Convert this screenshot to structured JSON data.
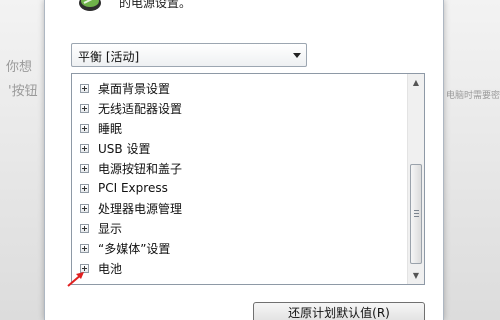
{
  "header": {
    "text": "的电源设置。"
  },
  "plan_select": {
    "value": "平衡 [活动]"
  },
  "tree": {
    "items": [
      {
        "label": "桌面背景设置"
      },
      {
        "label": "无线适配器设置"
      },
      {
        "label": "睡眠"
      },
      {
        "label": "USB 设置"
      },
      {
        "label": "电源按钮和盖子"
      },
      {
        "label": "PCI Express"
      },
      {
        "label": "处理器电源管理"
      },
      {
        "label": "显示"
      },
      {
        "label": "“多媒体”设置"
      },
      {
        "label": "电池"
      }
    ]
  },
  "buttons": {
    "restore_defaults": "还原计划默认值(R)"
  },
  "background": {
    "left_line1": "你想",
    "left_line2": "'按钮",
    "right_small": "电脑时需要密"
  },
  "colors": {
    "annotation_arrow": "#e02020"
  }
}
